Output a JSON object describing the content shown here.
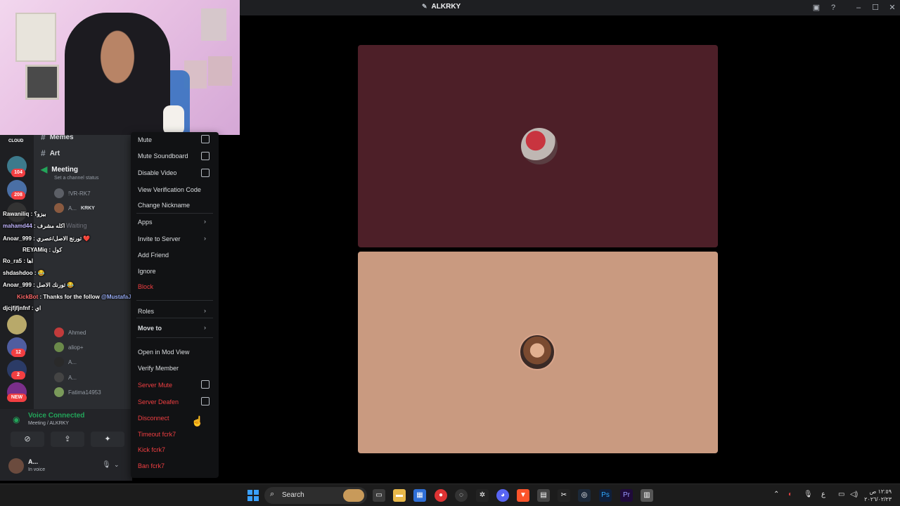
{
  "window": {
    "title": "ALKRKY"
  },
  "webcam": {
    "label": ""
  },
  "channels": {
    "items": [
      {
        "label": "Memes"
      },
      {
        "label": "Art"
      },
      {
        "label": "Meeting"
      }
    ],
    "status_placeholder": "Set a channel status",
    "waiting_label": "Waiting",
    "members": [
      {
        "name": "!VR-RK7"
      },
      {
        "name": "A...",
        "tag": "KRKY"
      },
      {
        "name": "Ahmed"
      },
      {
        "name": "aliop+"
      },
      {
        "name": "A..."
      },
      {
        "name": "A..."
      },
      {
        "name": "Fatima14953"
      }
    ]
  },
  "servers": {
    "badges": [
      "104",
      "208",
      "12",
      "2"
    ],
    "cloud_label": "CLOUD",
    "new_label": "NEW"
  },
  "chat": {
    "lines": [
      {
        "user": "Rawaniliq",
        "text": ": بيزو؟"
      },
      {
        "user": "mahamd44",
        "text": ": اكله مشرف"
      },
      {
        "user": "Anoar_999",
        "text": ": تورنج الاصل/عصري ❤️"
      },
      {
        "user": "REYAMiq",
        "text": ": كول"
      },
      {
        "user": "Ro_ra5",
        "text": ": اها"
      },
      {
        "user": "shdashdoo",
        "text": ": 😂"
      },
      {
        "user": "Anoar_999",
        "text": ": تورنك الاصل 😂"
      },
      {
        "user": "KickBot",
        "text": ": Thanks for the follow",
        "mention": "@MustafaJR_IQ"
      },
      {
        "user": "djcjfjfjnfnf",
        "text": ": اي"
      }
    ]
  },
  "voice": {
    "title": "Voice Connected",
    "subtitle": "Meeting / ALKRKY",
    "user_name": "A...",
    "user_status": "In voice"
  },
  "menu": {
    "items": [
      {
        "label": "Mute"
      },
      {
        "label": "Mute Soundboard"
      },
      {
        "label": "Disable Video"
      },
      {
        "label": "View Verification Code"
      },
      {
        "label": "Change Nickname"
      },
      {
        "label": "Apps"
      },
      {
        "label": "Invite to Server"
      },
      {
        "label": "Add Friend"
      },
      {
        "label": "Ignore"
      },
      {
        "label": "Block"
      },
      {
        "label": "Roles"
      },
      {
        "label": "Move to"
      },
      {
        "label": "Open in Mod View"
      },
      {
        "label": "Verify Member"
      },
      {
        "label": "Server Mute"
      },
      {
        "label": "Server Deafen"
      },
      {
        "label": "Disconnect"
      },
      {
        "label": "Timeout fcrk7"
      },
      {
        "label": "Kick fcrk7"
      },
      {
        "label": "Ban fcrk7"
      }
    ]
  },
  "taskbar": {
    "search_label": "Search",
    "clock_time": "١٢:٥٩ ص",
    "clock_date": "٢٠٢٦/٠٢/٢٣",
    "lang": "ع"
  },
  "colors": {
    "accent": "#5865f2",
    "danger": "#f23f42",
    "voice_green": "#23a55a",
    "tile_top": "#4d1f28",
    "tile_bottom": "#c99a80"
  }
}
